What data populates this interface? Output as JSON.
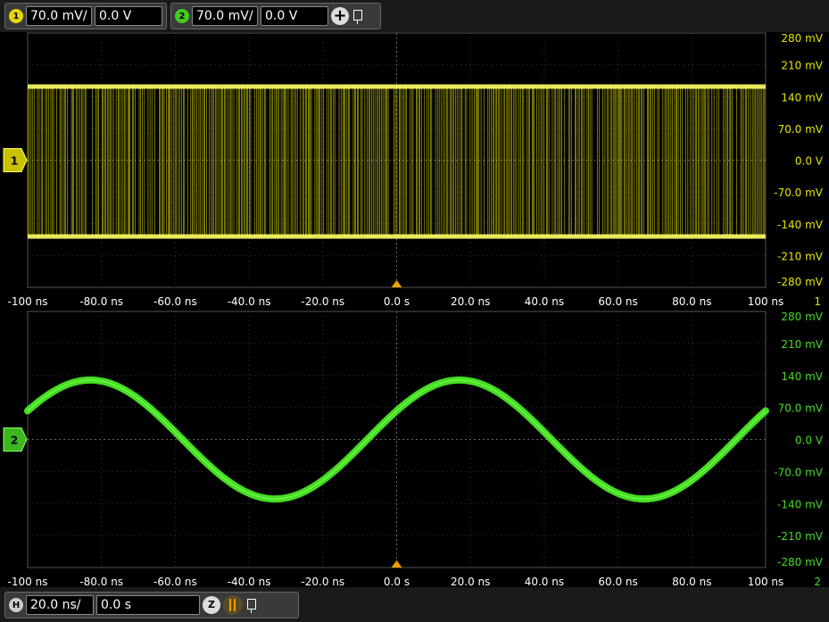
{
  "top_toolbar": {
    "ch1": {
      "badge": "1",
      "scale": "70.0 mV/",
      "offset": "0.0 V",
      "color": "#f0f000"
    },
    "ch2": {
      "badge": "2",
      "scale": "70.0 mV/",
      "offset": "0.0 V",
      "color": "#44dd22"
    },
    "add_icon": "plus-icon",
    "pin_icon": "pin-icon"
  },
  "bottom_toolbar": {
    "h_badge": "H",
    "timebase": "20.0 ns/",
    "position": "0.0 s",
    "zoom_badge": "Z",
    "zoom_icon": "zoom-icon",
    "marker_icon": "delay-marker-icon",
    "pin_icon": "pin-icon"
  },
  "chart_data": [
    {
      "type": "line",
      "panel_label": "1",
      "color": "#e6e600",
      "description_shown": "dense square-wave-like signal",
      "x_ticks": [
        "-100 ns",
        "-80.0 ns",
        "-60.0 ns",
        "-40.0 ns",
        "-20.0 ns",
        "0.0 s",
        "20.0 ns",
        "40.0 ns",
        "60.0 ns",
        "80.0 ns",
        "100 ns"
      ],
      "y_ticks": [
        "280 mV",
        "210 mV",
        "140 mV",
        "70.0 mV",
        "0.0 V",
        "-70.0 mV",
        "-140 mV",
        "-210 mV",
        "-280 mV"
      ],
      "xlim": [
        -100,
        100
      ],
      "ylim": [
        -280,
        280
      ],
      "high_level_mV": 162,
      "low_level_mV": -168,
      "grid": true
    },
    {
      "type": "line",
      "panel_label": "2",
      "color": "#44dd22",
      "x_ticks": [
        "-100 ns",
        "-80.0 ns",
        "-60.0 ns",
        "-40.0 ns",
        "-20.0 ns",
        "0.0 s",
        "20.0 ns",
        "40.0 ns",
        "60.0 ns",
        "80.0 ns",
        "100 ns"
      ],
      "y_ticks": [
        "280 mV",
        "210 mV",
        "140 mV",
        "70.0 mV",
        "0.0 V",
        "-70.0 mV",
        "-140 mV",
        "-210 mV",
        "-280 mV"
      ],
      "xlim": [
        -100,
        100
      ],
      "ylim": [
        -280,
        280
      ],
      "amplitude_mV": 130,
      "period_ns": 100,
      "phase_zero_crossing_ns": -8,
      "grid": true
    }
  ]
}
